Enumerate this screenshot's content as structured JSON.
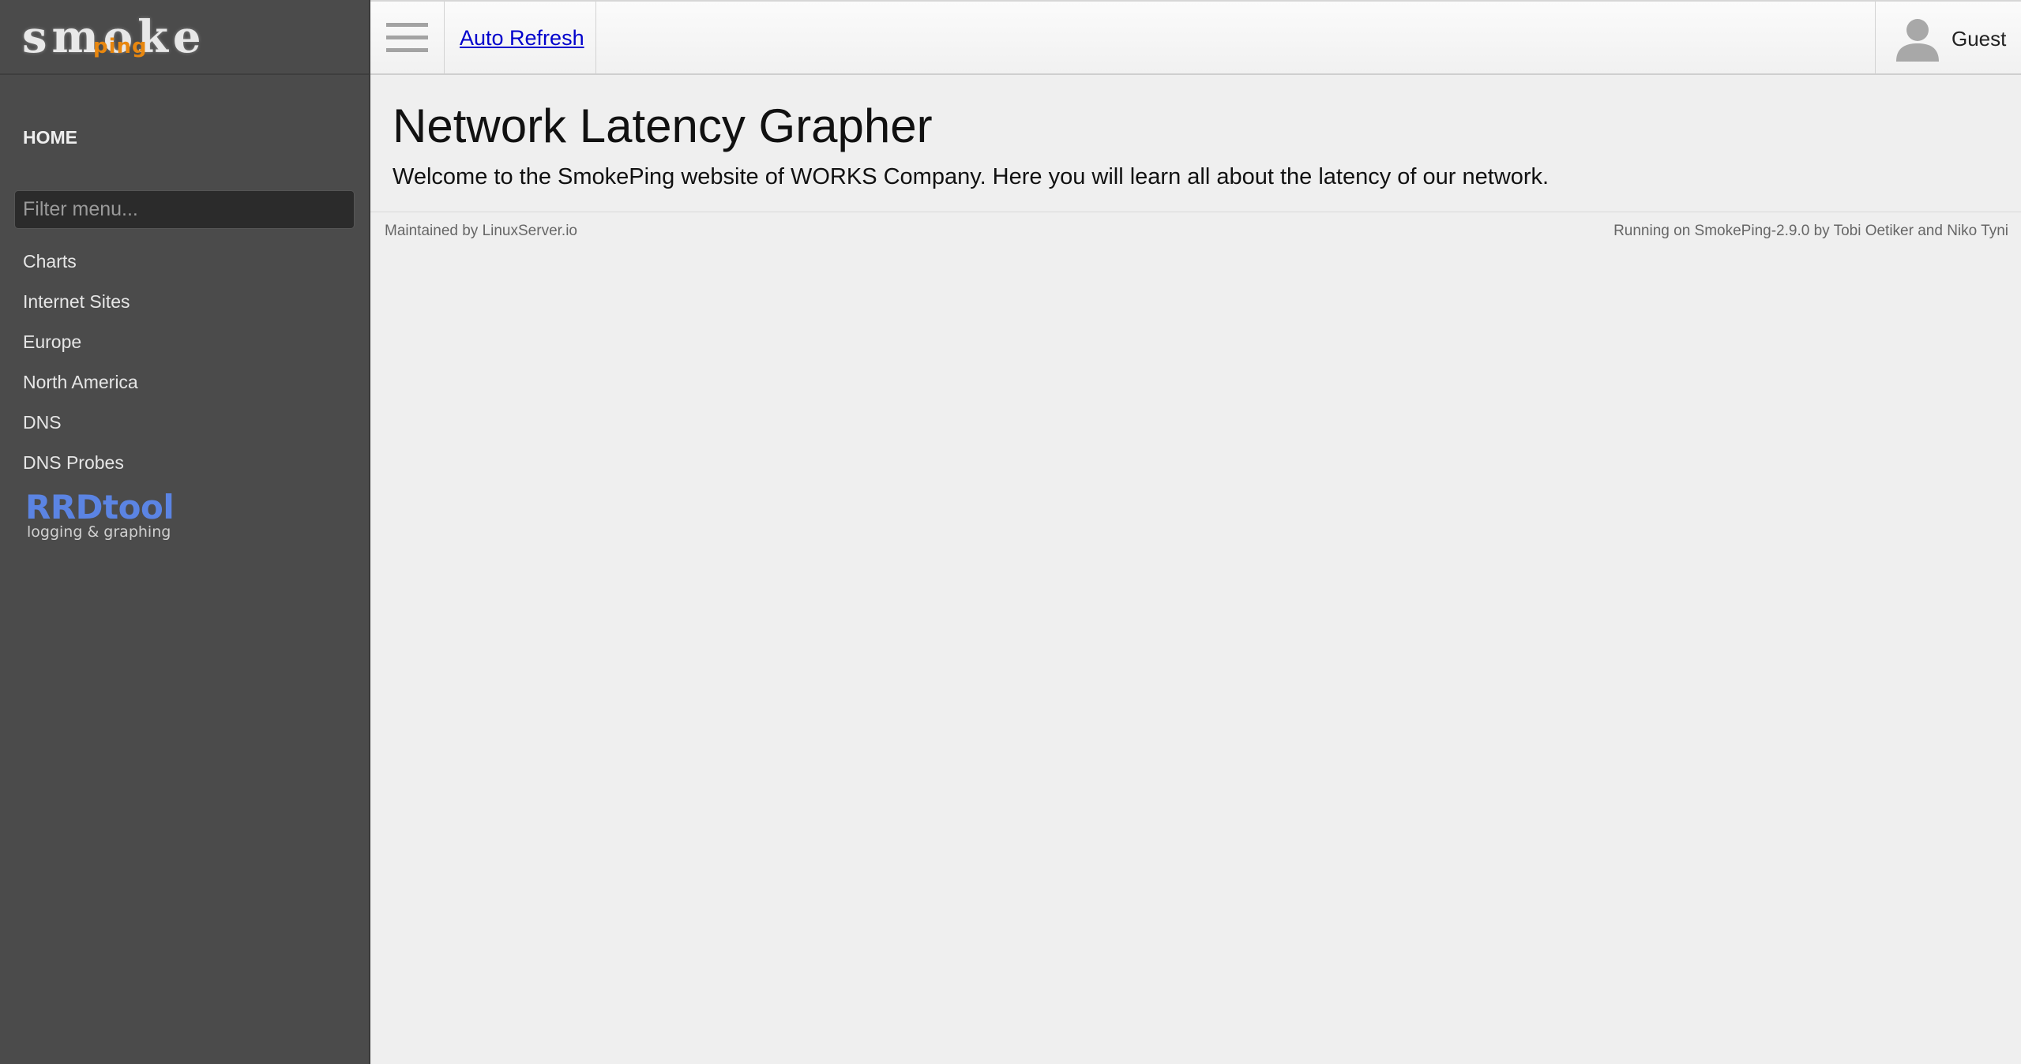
{
  "logo": {
    "smoke": "smoke",
    "ping": "ping"
  },
  "sidebar": {
    "home_label": "HOME",
    "filter_placeholder": "Filter menu...",
    "items": [
      {
        "label": "Charts"
      },
      {
        "label": "Internet Sites"
      },
      {
        "label": "Europe"
      },
      {
        "label": "North America"
      },
      {
        "label": "DNS"
      },
      {
        "label": "DNS Probes"
      }
    ],
    "rrdtool": {
      "title": "RRDtool",
      "subtitle": "logging & graphing"
    }
  },
  "topbar": {
    "menu_icon": "hamburger-icon",
    "auto_refresh_label": "Auto Refresh",
    "user_icon": "user-icon",
    "user_label": "Guest"
  },
  "main": {
    "title": "Network Latency Grapher",
    "welcome": "Welcome to the SmokePing website of WORKS Company. Here you will learn all about the latency of our network."
  },
  "footer": {
    "left": "Maintained by LinuxServer.io",
    "right": "Running on SmokePing-2.9.0 by Tobi Oetiker and Niko Tyni"
  },
  "colors": {
    "sidebar_bg": "#4b4b4b",
    "main_bg": "#efefef",
    "logo_accent": "#e8870f",
    "link": "#0000cc",
    "rrdtool_blue": "#5b84e3"
  }
}
